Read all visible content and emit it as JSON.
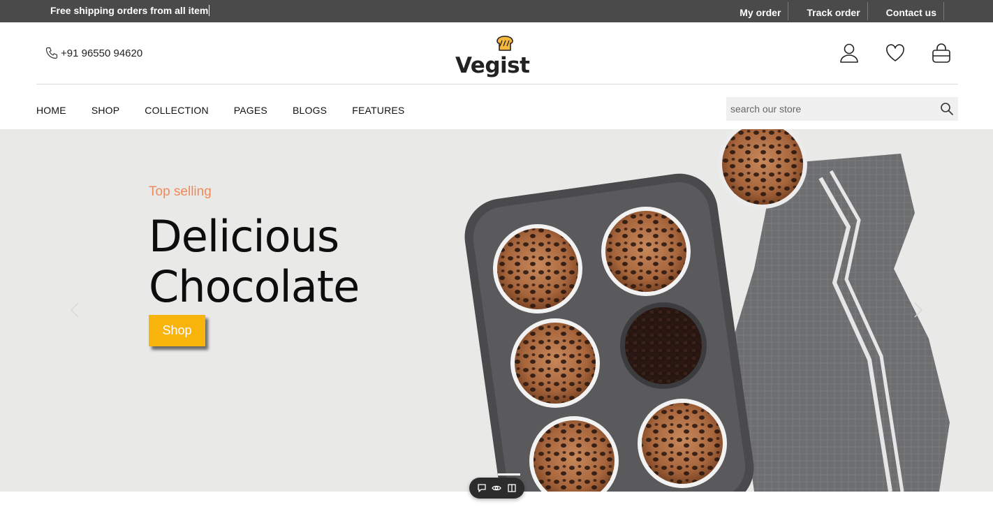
{
  "topbar": {
    "promo": "Free shipping orders from all item",
    "links": [
      "My order",
      "Track order",
      "Contact us"
    ]
  },
  "header": {
    "phone": "+91 96550 94620",
    "logo_text": "Vegist",
    "icons": [
      "user-icon",
      "heart-icon",
      "shopping-bag-icon"
    ]
  },
  "nav": {
    "items": [
      "HOME",
      "SHOP",
      "COLLECTION",
      "PAGES",
      "BLOGS",
      "FEATURES"
    ]
  },
  "search": {
    "placeholder": "search our store"
  },
  "hero": {
    "kicker": "Top selling",
    "title_line1": "Delicious",
    "title_line2": "Chocolate",
    "cta": "Shop"
  },
  "colors": {
    "topbar_bg": "#4a4a4a",
    "kicker": "#ef8a5a",
    "cta_bg": "#f8b40a",
    "hero_bg": "#e9e9e8"
  },
  "pill_icons": [
    "comment-icon",
    "eye-icon",
    "panel-icon"
  ]
}
